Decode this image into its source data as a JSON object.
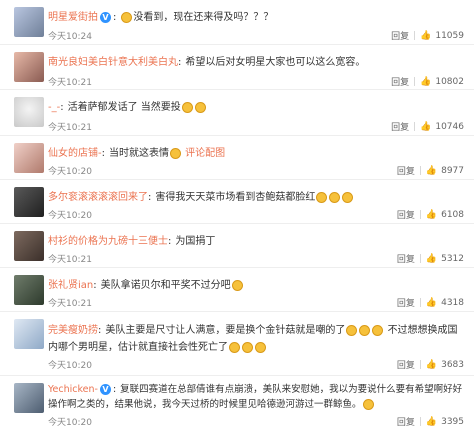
{
  "comments": [
    {
      "user": "明星爱街拍",
      "verified": true,
      "text_before": "没看到，现在还来得及吗？？？",
      "text_after": "",
      "time": "今天10:24",
      "reply": "回复",
      "likes": "11059"
    },
    {
      "user": "南光良妇美白针意大利美白丸",
      "verified": false,
      "text_before": "希望以后对女明星大家也可以这么宽容。",
      "text_after": "",
      "time": "今天10:21",
      "reply": "回复",
      "likes": "10802"
    },
    {
      "user": "-_-",
      "verified": false,
      "text_before": "活着萨郁发话了 当然要投",
      "text_after": "",
      "time": "今天10:21",
      "reply": "回复",
      "likes": "10746"
    },
    {
      "user": "仙女的店铺-",
      "verified": false,
      "text_before": "当时就这表情",
      "text_after": "评论配图",
      "time": "今天10:20",
      "reply": "回复",
      "likes": "8977"
    },
    {
      "user": "多尔衮滚滚滚滚回来了",
      "verified": false,
      "text_before": "害得我天天菜市场看到杏鲍菇都脸红",
      "text_after": "",
      "time": "今天10:20",
      "reply": "回复",
      "likes": "6108"
    },
    {
      "user": "村衫的价格为九磅十三便士",
      "verified": false,
      "text_before": "为国捐丁",
      "text_after": "",
      "time": "今天10:21",
      "reply": "回复",
      "likes": "5312"
    },
    {
      "user": "张礼贤ian",
      "verified": false,
      "text_before": "美队拿诺贝尔和平奖不过分吧",
      "text_after": "",
      "time": "今天10:21",
      "reply": "回复",
      "likes": "4318"
    },
    {
      "user": "完美瘦奶捞",
      "verified": false,
      "text_before": "美队主要是尺寸让人满意，要是换个金针菇就是嘲的了",
      "text_after": "不过想想换成国内哪个男明星，估计就直接社会性死亡了",
      "time": "今天10:20",
      "reply": "回复",
      "likes": "3683"
    },
    {
      "user": "Yechicken-",
      "verified": true,
      "text_before": "复联四赛道在总部倩谁有点崩溃，美队来安慰她，我以为要说什么要有希望啊好好操作啊之类的，结果他说，我今天过桥的时候里见哈德逊河游过一群鲸鱼。",
      "text_after": "",
      "time": "今天10:20",
      "reply": "回复",
      "likes": "3395"
    }
  ],
  "colors": {
    "username": "#eb7350",
    "verified_badge": "#2f93ff",
    "time": "#888888"
  },
  "icons": {
    "like": "thumbs-up-icon",
    "verified": "verified-v-badge-icon",
    "emoji": "smiley-emoji-icon"
  }
}
